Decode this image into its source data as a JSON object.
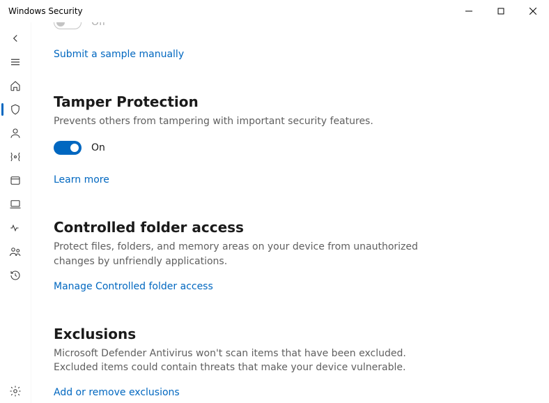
{
  "window": {
    "title": "Windows Security"
  },
  "cutoff": {
    "state_label": "Off"
  },
  "links": {
    "submit_sample": "Submit a sample manually",
    "learn_more": "Learn more",
    "manage_cfa": "Manage Controlled folder access",
    "add_exclusions": "Add or remove exclusions"
  },
  "tamper": {
    "title": "Tamper Protection",
    "desc": "Prevents others from tampering with important security features.",
    "state_label": "On"
  },
  "cfa": {
    "title": "Controlled folder access",
    "desc": "Protect files, folders, and memory areas on your device from unauthorized changes by unfriendly applications."
  },
  "exclusions": {
    "title": "Exclusions",
    "desc": "Microsoft Defender Antivirus won't scan items that have been excluded. Excluded items could contain threats that make your device vulnerable."
  }
}
